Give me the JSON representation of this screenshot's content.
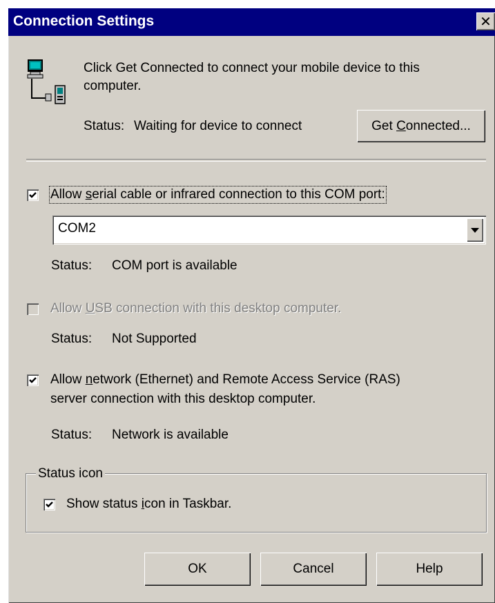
{
  "window": {
    "title": "Connection Settings",
    "close_glyph": "✕"
  },
  "intro": {
    "icon": "computer-device-connection-icon",
    "message_line1": "Click Get Connected to connect your mobile device to this",
    "message_line2": "computer.",
    "status_label": "Status:",
    "status_value": "Waiting for device to connect",
    "get_connected_pre": "Get ",
    "get_connected_mnemonic": "C",
    "get_connected_post": "onnected..."
  },
  "serial": {
    "checked": true,
    "label_pre": "Allow ",
    "label_mnemonic": "s",
    "label_post": "erial cable or infrared connection to this COM port:",
    "port_value": "COM2",
    "status_label": "Status:",
    "status_value": "COM port is available"
  },
  "usb": {
    "checked": false,
    "enabled": false,
    "label_pre": "Allow ",
    "label_mnemonic": "U",
    "label_post": "SB connection with this desktop computer.",
    "status_label": "Status:",
    "status_value": "Not Supported"
  },
  "network": {
    "checked": true,
    "label_line1_pre": "Allow ",
    "label_line1_mnemonic": "n",
    "label_line1_post": "etwork (Ethernet) and Remote Access Service (RAS)",
    "label_line2": "server connection with this desktop computer.",
    "status_label": "Status:",
    "status_value": "Network is available"
  },
  "status_icon_group": {
    "title": "Status icon",
    "checked": true,
    "label_pre": "Show status ",
    "label_mnemonic": "i",
    "label_post": "con in Taskbar."
  },
  "buttons": {
    "ok": "OK",
    "cancel": "Cancel",
    "help": "Help"
  },
  "colors": {
    "titlebar": "#000080",
    "face": "#d4d0c8",
    "disabled_text": "#808080"
  }
}
